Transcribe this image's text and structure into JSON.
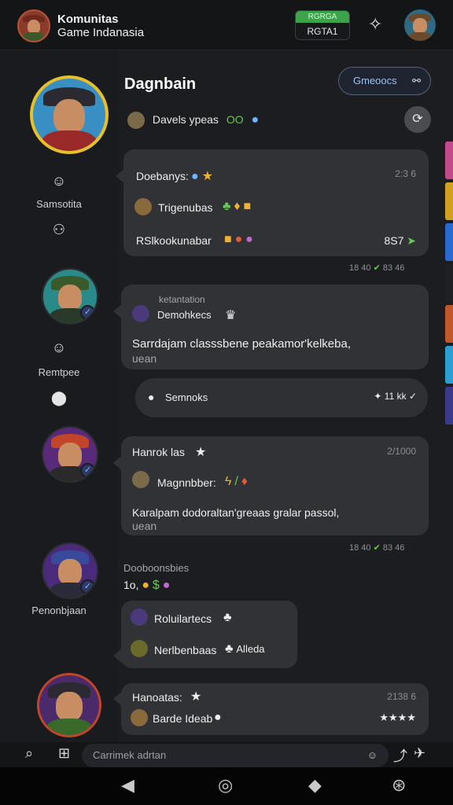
{
  "header": {
    "title_line1": "Komunitas",
    "title_line2": "Game Indanasia",
    "badge_top": "RGRGA",
    "badge_bottom": "RGTA1"
  },
  "rail": {
    "items": [
      {
        "label": "Samsotita"
      },
      {
        "label": "Remtpee"
      },
      {
        "label": "Penonbjaan"
      }
    ]
  },
  "main": {
    "title": "Dagnbain",
    "groups_button": "Gmeoocs",
    "subheader": {
      "name": "Davels ypeas",
      "tag": "OO"
    }
  },
  "messages": [
    {
      "title": "Doebanys:",
      "time": "2:3 6",
      "line2": "Trigenubas",
      "line3": "RSlkookunabar",
      "count": "8S7",
      "meta_time": "18 40",
      "meta_count": "83 46"
    },
    {
      "title_small": "ketantation",
      "subtitle": "Demohkecs",
      "body1": "Sarrdajam classsbene peakamor'kelkeba,",
      "body2": "uean"
    },
    {
      "reply_label": "Semnoks",
      "reply_count": "11 kk"
    },
    {
      "title": "Hanrok las",
      "time": "2/1000",
      "line2": "Magnnbber:",
      "body1": "Karalpam dodoraltan'greaas gralar passol,",
      "body2": "uean",
      "meta_time": "18 40",
      "meta_count": "83 46"
    },
    {
      "header_name": "Dooboonsbies",
      "header_sub": "1o,",
      "line1": "Roluilartecs",
      "line2": "Nerlbenbaas",
      "line2_tag": "Alleda"
    },
    {
      "title": "Hanoatas:",
      "time": "2138 6",
      "line2": "Barde Ideab"
    }
  ],
  "composer": {
    "placeholder": "Carrimek adrtan"
  },
  "colors": {
    "accent_green": "#3ca34a",
    "accent_blue": "#6eb4ff",
    "bubble": "#303236",
    "background": "#1c1d20"
  }
}
